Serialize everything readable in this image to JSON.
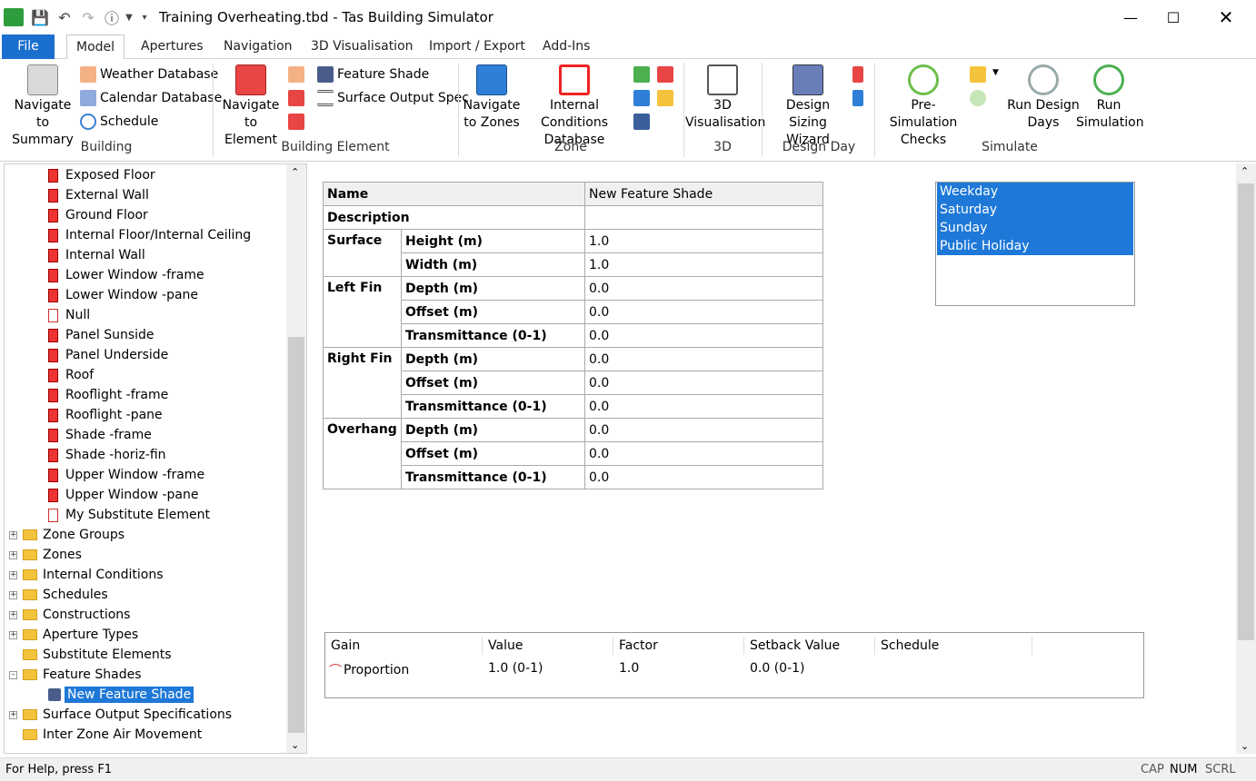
{
  "window": {
    "title": "Training Overheating.tbd - Tas Building Simulator"
  },
  "tabs": [
    "File",
    "Model",
    "Apertures",
    "Navigation",
    "3D Visualisation",
    "Import / Export",
    "Add-Ins"
  ],
  "ribbon": {
    "building": {
      "navigate_summary": "Navigate to Summary",
      "nav_line1": "Navigate to",
      "nav_line2": "Summary",
      "weather": "Weather Database",
      "calendar": "Calendar Database",
      "schedule": "Schedule",
      "group": "Building"
    },
    "element": {
      "nav_line1": "Navigate",
      "nav_line2": "to Element",
      "feature_shade": "Feature Shade",
      "surface_output": "Surface Output Spec",
      "group": "Building Element"
    },
    "zone": {
      "nav_line1": "Navigate",
      "nav_line2": "to Zones",
      "ic_line1": "Internal Conditions",
      "ic_line2": "Database",
      "group": "Zone"
    },
    "viz": {
      "line1": "3D",
      "line2": "Visualisation",
      "group": "3D"
    },
    "design": {
      "line1": "Design",
      "line2": "Sizing Wizard",
      "group": "Design Day"
    },
    "simulate": {
      "pre_line1": "Pre-Simulation",
      "pre_line2": "Checks",
      "rdd_line1": "Run Design",
      "rdd_line2": "Days",
      "run_line1": "Run",
      "run_line2": "Simulation",
      "group": "Simulate"
    }
  },
  "tree": {
    "elements": [
      "Exposed Floor",
      "External Wall",
      "Ground Floor",
      "Internal Floor/Internal Ceiling",
      "Internal Wall",
      "Lower Window -frame",
      "Lower Window -pane",
      "Null",
      "Panel Sunside",
      "Panel Underside",
      "Roof",
      "Rooflight -frame",
      "Rooflight -pane",
      "Shade -frame",
      "Shade -horiz-fin",
      "Upper Window -frame",
      "Upper Window -pane",
      "My Substitute Element"
    ],
    "folders": [
      "Zone Groups",
      "Zones",
      "Internal Conditions",
      "Schedules",
      "Constructions",
      "Aperture Types",
      "Substitute Elements",
      "Feature Shades"
    ],
    "selected": "New Feature Shade",
    "folders_after": [
      "Surface Output Specifications",
      "Inter Zone Air Movement"
    ]
  },
  "props": {
    "name_label": "Name",
    "name_value": "New Feature Shade",
    "desc_label": "Description",
    "surface": "Surface",
    "height": "Height (m)",
    "width": "Width (m)",
    "h_val": "1.0",
    "w_val": "1.0",
    "left_fin": "Left Fin",
    "right_fin": "Right Fin",
    "overhang": "Overhang",
    "depth": "Depth (m)",
    "offset": "Offset (m)",
    "trans": "Transmittance (0-1)",
    "zero": "0.0"
  },
  "days": [
    "Weekday",
    "Saturday",
    "Sunday",
    "Public Holiday"
  ],
  "gains": {
    "headers": [
      "Gain",
      "Value",
      "Factor",
      "Setback Value",
      "Schedule"
    ],
    "row": {
      "gain": "Proportion",
      "value": "1.0 (0-1)",
      "factor": "1.0",
      "setback": "0.0 (0-1)",
      "schedule": ""
    }
  },
  "status": {
    "help": "For Help, press F1",
    "cap": "CAP",
    "num": "NUM",
    "scrl": "SCRL"
  }
}
